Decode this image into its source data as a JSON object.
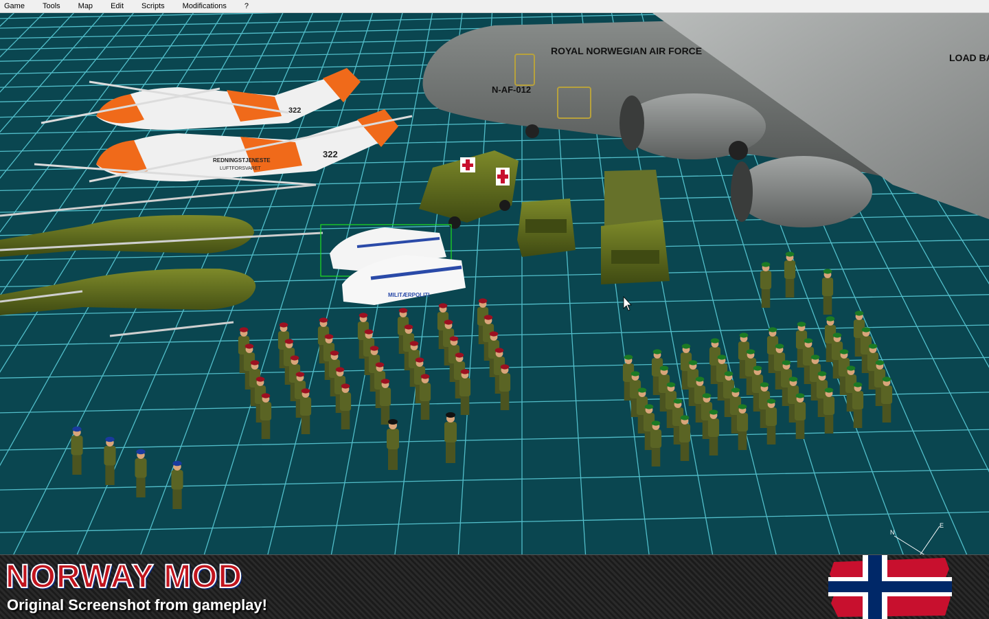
{
  "menu": {
    "items": [
      "Game",
      "Tools",
      "Map",
      "Edit",
      "Scripts",
      "Modifications",
      "?"
    ]
  },
  "scene": {
    "aircraft_label": "ROYAL NORWEGIAN AIR FORCE",
    "aircraft_reg": "N-AF-012",
    "aircraft_door_text": "LOAD BAY",
    "helicopter_label": "REDNINGSTJENESTE",
    "helicopter_sub": "LUFTFORSVARET",
    "helicopter_number": "322",
    "police_car_label": "MILITÆRPOLITI"
  },
  "banner": {
    "title": "NORWAY MOD",
    "subtitle": "Original Screenshot from gameplay!"
  },
  "compass": {
    "north": "N",
    "east": "E"
  },
  "colors": {
    "ground": "#0a4650",
    "grid": "#5fd4e0",
    "olive": "#5d6b1e",
    "rescue_orange": "#f06a1a",
    "flag_red": "#c8102e",
    "flag_blue": "#002868"
  }
}
